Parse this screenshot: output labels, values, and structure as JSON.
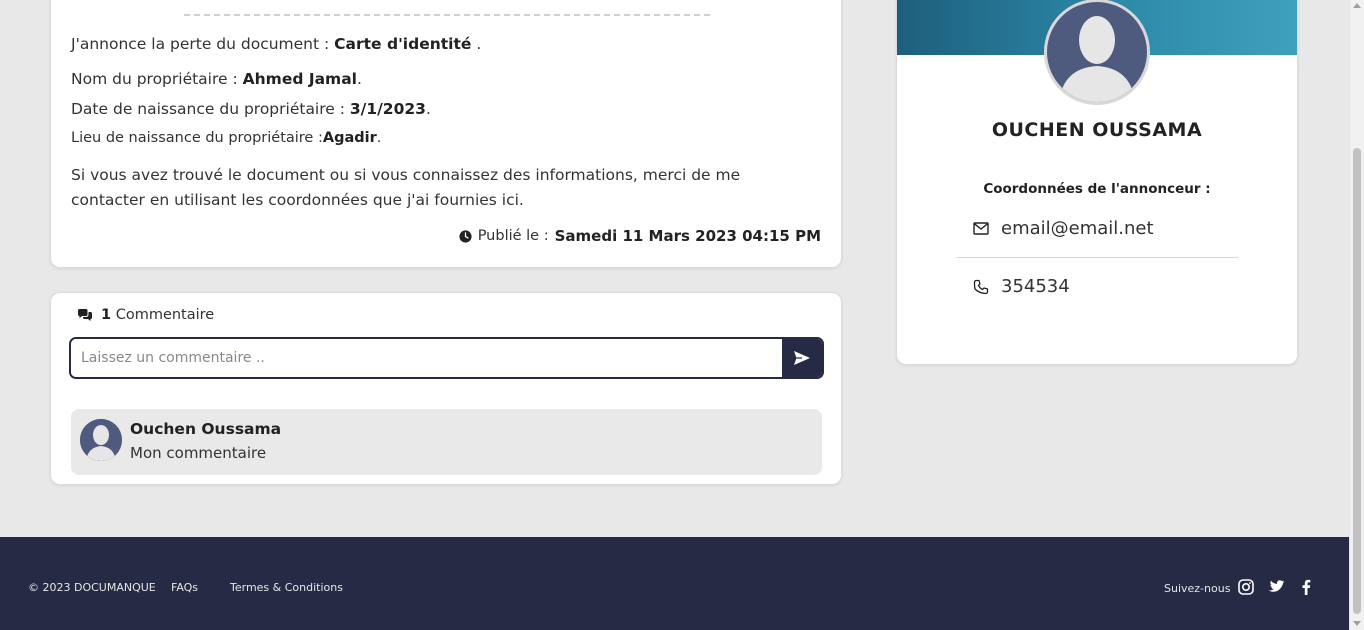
{
  "document": {
    "loss_prefix": "J'annonce la perte du document : ",
    "doc_type": "Carte d'identité",
    "loss_suffix": " .",
    "owner_label": "Nom du propriétaire : ",
    "owner_name": "Ahmed Jamal",
    "birthdate_label": "Date de naissance du propriétaire : ",
    "birthdate": "3/1/2023",
    "birthplace_label": "Lieu de naissance du propriétaire :",
    "birthplace": "Agadir",
    "period": ".",
    "message": "Si vous avez trouvé le document ou si vous connaissez des informations, merci de me contacter en utilisant les coordonnées que j'ai fournies ici.",
    "published_label": "Publié le : ",
    "published_date": "Samedi 11 Mars 2023 04:15 PM"
  },
  "comments": {
    "count": "1",
    "count_label": "Commentaire",
    "input_placeholder": "Laissez un commentaire ..",
    "items": [
      {
        "author": "Ouchen Oussama",
        "text": "Mon commentaire"
      }
    ]
  },
  "profile": {
    "name": "OUCHEN OUSSAMA",
    "contact_title": "Coordonnées de l'annonceur :",
    "email": "email@email.net",
    "phone": "354534"
  },
  "footer": {
    "copyright": "© 2023 DOCUMANQUE",
    "faqs": "FAQs",
    "terms": "Termes & Conditions",
    "follow": "Suivez-nous",
    "social_icons": [
      "instagram-icon",
      "twitter-icon",
      "facebook-icon"
    ]
  },
  "colors": {
    "navy": "#262a45",
    "banner_start": "#1d5f7c",
    "banner_end": "#3fa0bd",
    "background": "#e8e8e8",
    "avatar": "#4e5a7e"
  }
}
